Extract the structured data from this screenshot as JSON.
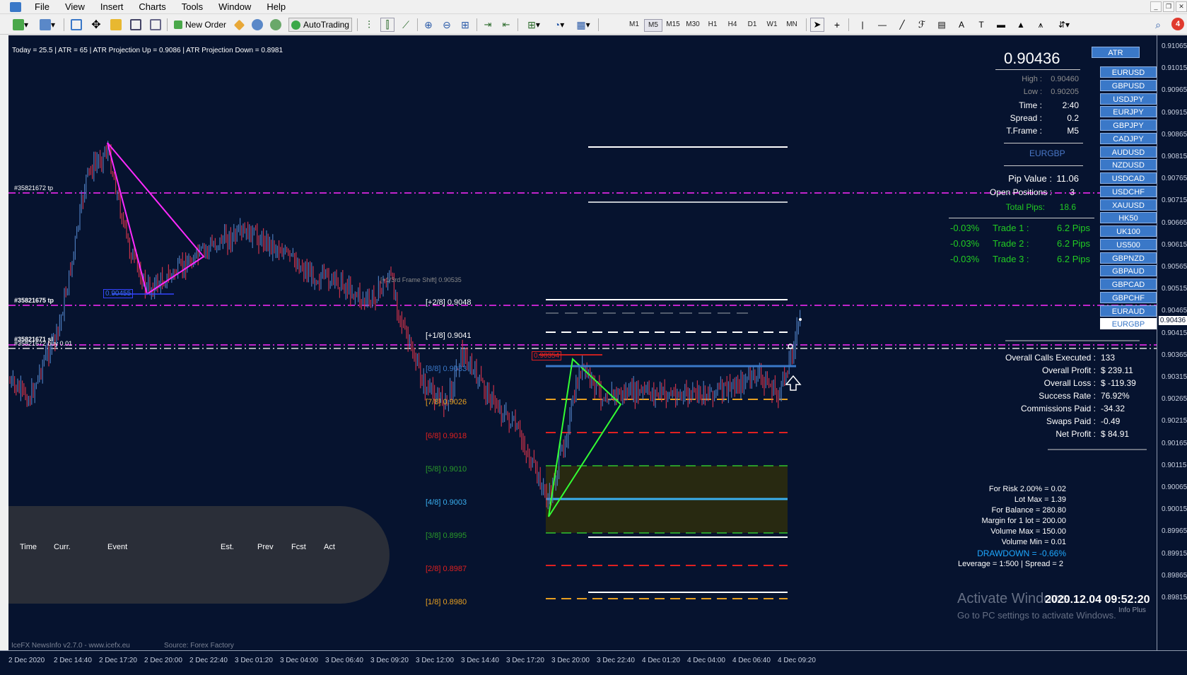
{
  "menu": [
    "File",
    "View",
    "Insert",
    "Charts",
    "Tools",
    "Window",
    "Help"
  ],
  "toolbar": {
    "new_order": "New Order",
    "autotrading": "AutoTrading",
    "timeframes": [
      "M1",
      "M5",
      "M15",
      "M30",
      "H1",
      "H4",
      "D1",
      "W1",
      "MN"
    ],
    "active_timeframe": "M5",
    "alerts_count": "4"
  },
  "info_bar": "Today = 25.5   |   ATR = 65   |   ATR Projection Up = 0.9086   |   ATR Projection Down = 0.8981",
  "panel": {
    "price": "0.90436",
    "atr_button": "ATR",
    "high_label": "High :",
    "high": "0.90460",
    "low_label": "Low :",
    "low": "0.90205",
    "time_label": "Time :",
    "time": "2:40",
    "spread_label": "Spread :",
    "spread": "0.2",
    "tframe_label": "T.Frame :",
    "tframe": "M5",
    "symbol": "EURGBP",
    "pip_value_label": "Pip Value :",
    "pip_value": "11.06",
    "open_positions_label": "Open Positions :",
    "open_positions": "3",
    "total_pips_label": "Total Pips:",
    "total_pips": "18.6",
    "trades": [
      {
        "pct": "-0.03%",
        "label": "Trade 1 :",
        "pips": "6.2 Pips"
      },
      {
        "pct": "-0.03%",
        "label": "Trade 2 :",
        "pips": "6.2 Pips"
      },
      {
        "pct": "-0.03%",
        "label": "Trade 3 :",
        "pips": "6.2 Pips"
      }
    ]
  },
  "symbols": [
    "EURUSD",
    "GBPUSD",
    "USDJPY",
    "EURJPY",
    "GBPJPY",
    "CADJPY",
    "AUDUSD",
    "NZDUSD",
    "USDCAD",
    "USDCHF",
    "XAUUSD",
    "HK50",
    "UK100",
    "US500",
    "GBPNZD",
    "GBPAUD",
    "GBPCAD",
    "GBPCHF",
    "EURAUD",
    "EURGBP"
  ],
  "stats": [
    {
      "label": "Overall Calls Executed :",
      "value": "133"
    },
    {
      "label": "Overall Profit :",
      "value": "$ 239.11"
    },
    {
      "label": "Overall Loss :",
      "value": "$ -119.39"
    },
    {
      "label": "Success Rate :",
      "value": "76.92%"
    },
    {
      "label": "Commissions Paid :",
      "value": "-34.32"
    },
    {
      "label": "Swaps Paid :",
      "value": "-0.49"
    },
    {
      "label": "Net Profit :",
      "value": "$ 84.91"
    }
  ],
  "risk": [
    "For Risk 2.00% = 0.02",
    "Lot Max = 1.39",
    "For Balance = 280.80",
    "Margin for 1 lot = 200.00",
    "Volume Max = 150.00",
    "Volume Min = 0.01"
  ],
  "drawdown": "DRAWDOWN = -0.66%",
  "leverage": "Leverage = 1:500 | Spread = 2",
  "datetime": "2020.12.04 09:52:20",
  "info_plus": "Info Plus",
  "activate_line1": "Activate Windows",
  "activate_line2": "Go to PC settings to activate Windows.",
  "murrey_levels": [
    {
      "label": "[+2/8]  0.9048",
      "color": "#ffffff"
    },
    {
      "label": "[+1/8]  0.9041",
      "color": "#ffffff"
    },
    {
      "label": "[8/8]  0.9033",
      "color": "#3a78c8"
    },
    {
      "label": "[7/8]  0.9026",
      "color": "#e8a020"
    },
    {
      "label": "[6/8]  0.9018",
      "color": "#e02020"
    },
    {
      "label": "[5/8]  0.9010",
      "color": "#2a9a2a"
    },
    {
      "label": "[4/8]  0.9003",
      "color": "#3ab0f0"
    },
    {
      "label": "[3/8]  0.8995",
      "color": "#2a9a2a"
    },
    {
      "label": "[2/8]  0.8987",
      "color": "#e02020"
    },
    {
      "label": "[1/8]  0.8980",
      "color": "#e8a020"
    }
  ],
  "frame_shift": "[+1/3rd Frame Shift]  0.90535",
  "price_tag": "0.90354",
  "fib_tag": "0.90455",
  "order_labels": [
    "#35821672 tp",
    "#35821675 tp",
    "#35821671 sl",
    "#35821672 buy 0.01"
  ],
  "news": {
    "headers": [
      "Time",
      "Curr.",
      "Event",
      "Est.",
      "Prev",
      "Fcst",
      "Act"
    ],
    "footer": "IceFX NewsInfo v2.7.0  -  www.icefx.eu",
    "source": "Source: Forex Factory"
  },
  "price_axis": [
    "0.91065",
    "0.91015",
    "0.90965",
    "0.90915",
    "0.90865",
    "0.90815",
    "0.90765",
    "0.90715",
    "0.90665",
    "0.90615",
    "0.90565",
    "0.90515",
    "0.90465",
    "0.90415",
    "0.90365",
    "0.90315",
    "0.90265",
    "0.90215",
    "0.90165",
    "0.90115",
    "0.90065",
    "0.90015",
    "0.89965",
    "0.89915",
    "0.89865",
    "0.89815"
  ],
  "current_price_tag": "0.90436",
  "time_axis": [
    "2 Dec 2020",
    "2 Dec 14:40",
    "2 Dec 17:20",
    "2 Dec 20:00",
    "2 Dec 22:40",
    "3 Dec 01:20",
    "3 Dec 04:00",
    "3 Dec 06:40",
    "3 Dec 09:20",
    "3 Dec 12:00",
    "3 Dec 14:40",
    "3 Dec 17:20",
    "3 Dec 20:00",
    "3 Dec 22:40",
    "4 Dec 01:20",
    "4 Dec 04:00",
    "4 Dec 06:40",
    "4 Dec 09:20"
  ],
  "colors": {
    "chart_bg": "#06132f",
    "bull": "#4a78b8",
    "bear": "#c8324a",
    "magenta": "#ff2aff",
    "green": "#33ff33",
    "trade_green": "#22cc22"
  }
}
